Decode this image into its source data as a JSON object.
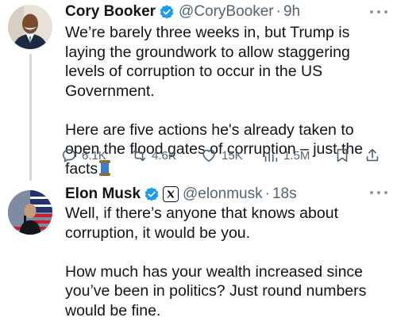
{
  "tweets": [
    {
      "author": {
        "name": "Cory Booker",
        "handle": "@CoryBooker",
        "time": "9h",
        "verified": true
      },
      "paragraphs": [
        "We’re barely three weeks in, but Trump is laying the groundwork to allow staggering levels of corruption to occur in the US Government.",
        "Here are five actions he's already taken to open the flood gates of corruption – just the facts"
      ],
      "emoji": "spool-of-thread-emoji",
      "stats": {
        "replies": "6.1K",
        "reposts": "4.6K",
        "likes": "15K",
        "views": "1.5M"
      }
    },
    {
      "author": {
        "name": "Elon Musk",
        "handle": "@elonmusk",
        "time": "18s",
        "verified": true,
        "affiliate_badge": "X"
      },
      "paragraphs": [
        "Well, if there’s anyone that knows about corruption, it would be you.",
        "How much has your wealth increased since you’ve been in politics? Just round numbers would be fine."
      ]
    }
  ],
  "colors": {
    "text": "#0f1419",
    "secondary": "#536471",
    "verified": "#1d9bf0",
    "thread_line": "#cfd9de"
  },
  "icons": [
    "reply-icon",
    "repost-icon",
    "like-icon",
    "views-icon",
    "bookmark-icon",
    "share-icon",
    "more-icon",
    "verified-icon",
    "x-logo-icon"
  ]
}
